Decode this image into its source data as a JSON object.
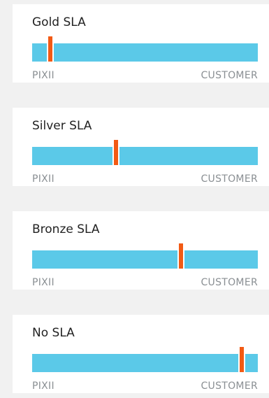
{
  "colors": {
    "page_background": "#f1f1f1",
    "card_background": "#ffffff",
    "bar_fill": "#5bc9e8",
    "marker": "#f25a14",
    "title_text": "#222222",
    "side_label_text": "#8a8f93"
  },
  "sla_cards": [
    {
      "title": "Gold SLA",
      "left_label": "PIXII",
      "right_label": "CUSTOMER",
      "marker_position_percent": 8
    },
    {
      "title": "Silver SLA",
      "left_label": "PIXII",
      "right_label": "CUSTOMER",
      "marker_position_percent": 37
    },
    {
      "title": "Bronze SLA",
      "left_label": "PIXII",
      "right_label": "CUSTOMER",
      "marker_position_percent": 66
    },
    {
      "title": "No SLA",
      "left_label": "PIXII",
      "right_label": "CUSTOMER",
      "marker_position_percent": 93
    }
  ]
}
